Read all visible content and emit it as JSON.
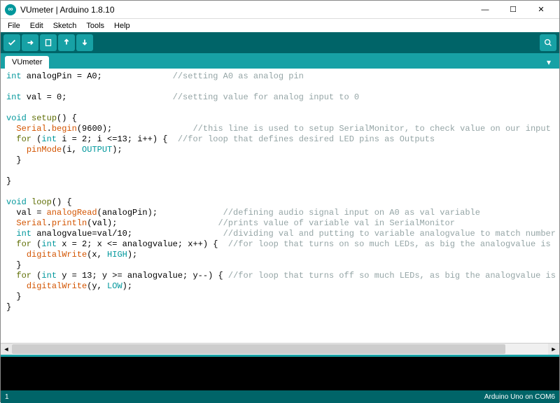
{
  "window": {
    "title": "VUmeter | Arduino 1.8.10",
    "icon_text": "∞"
  },
  "menu": {
    "file": "File",
    "edit": "Edit",
    "sketch": "Sketch",
    "tools": "Tools",
    "help": "Help"
  },
  "tab": {
    "name": "VUmeter"
  },
  "code": {
    "l1_a": "int",
    "l1_b": " analogPin = A0;              ",
    "l1_c": "//setting A0 as analog pin",
    "l2_a": "int",
    "l2_b": " val = 0;                     ",
    "l2_c": "//setting value for analog input to 0",
    "l3_a": "void",
    "l3_b": " ",
    "l3_c": "setup",
    "l3_d": "() {",
    "l4_a": "  ",
    "l4_b": "Serial",
    "l4_c": ".",
    "l4_d": "begin",
    "l4_e": "(9600);                ",
    "l4_f": "//this line is used to setup SerialMonitor, to check value on our input",
    "l5_a": "  ",
    "l5_b": "for",
    "l5_c": " (",
    "l5_d": "int",
    "l5_e": " i = 2; i <=13; i++) {  ",
    "l5_f": "//for loop that defines desired LED pins as Outputs",
    "l6_a": "    ",
    "l6_b": "pinMode",
    "l6_c": "(i, ",
    "l6_d": "OUTPUT",
    "l6_e": ");",
    "l7": "  }",
    "l8": "}",
    "l9_a": "void",
    "l9_b": " ",
    "l9_c": "loop",
    "l9_d": "() {",
    "l10_a": "  val = ",
    "l10_b": "analogRead",
    "l10_c": "(analogPin);             ",
    "l10_d": "//defining audio signal input on A0 as val variable",
    "l11_a": "  ",
    "l11_b": "Serial",
    "l11_c": ".",
    "l11_d": "println",
    "l11_e": "(val);                    ",
    "l11_f": "//prints value of variable val in SerialMonitor",
    "l12_a": "  ",
    "l12_b": "int",
    "l12_c": " analogvalue=val/10;                  ",
    "l12_d": "//dividing val and putting to variable analogvalue to match number of our",
    "l13_a": "  ",
    "l13_b": "for",
    "l13_c": " (",
    "l13_d": "int",
    "l13_e": " x = 2; x <= analogvalue; x++) {  ",
    "l13_f": "//for loop that turns on so much LEDs, as big the analogvalue is",
    "l14_a": "    ",
    "l14_b": "digitalWrite",
    "l14_c": "(x, ",
    "l14_d": "HIGH",
    "l14_e": ");",
    "l15": "  }",
    "l16_a": "  ",
    "l16_b": "for",
    "l16_c": " (",
    "l16_d": "int",
    "l16_e": " y = 13; y >= analogvalue; y--) { ",
    "l16_f": "//for loop that turns off so much LEDs, as big the analogvalue is",
    "l17_a": "    ",
    "l17_b": "digitalWrite",
    "l17_c": "(y, ",
    "l17_d": "LOW",
    "l17_e": ");",
    "l18": "  }",
    "l19": "}"
  },
  "status": {
    "line": "1",
    "board": "Arduino Uno on COM6"
  }
}
